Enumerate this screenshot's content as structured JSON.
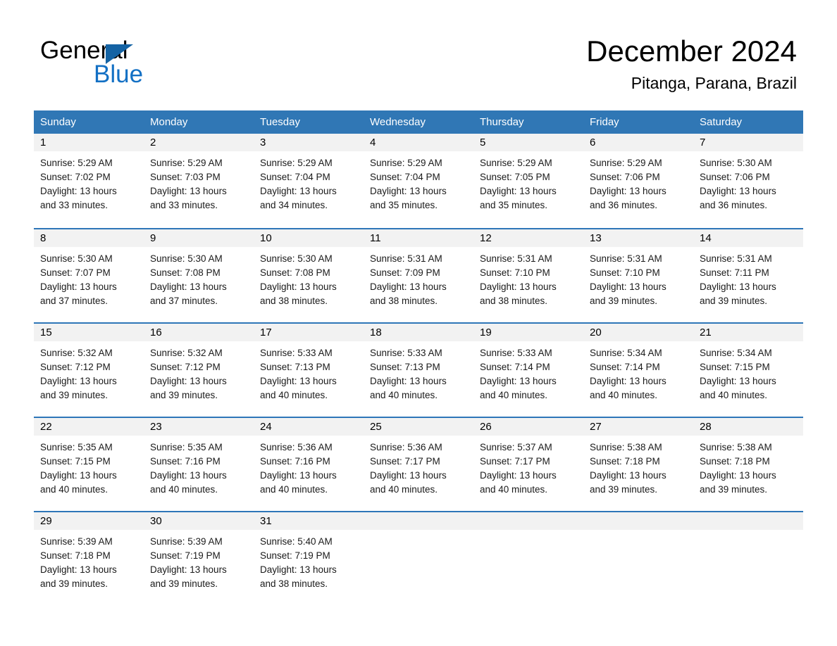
{
  "brand": {
    "name_line1": "General",
    "name_line2": "Blue",
    "triangle_icon": "triangle-icon",
    "black": "#000000",
    "blue": "#1370c4"
  },
  "header": {
    "month_title": "December 2024",
    "location": "Pitanga, Parana, Brazil"
  },
  "theme": {
    "header_blue": "#3077b5",
    "row_divider_blue": "#2e76b8",
    "day_strip_gray": "#f2f2f2"
  },
  "calendar": {
    "weekdays": [
      "Sunday",
      "Monday",
      "Tuesday",
      "Wednesday",
      "Thursday",
      "Friday",
      "Saturday"
    ],
    "weeks": [
      [
        {
          "day": "1",
          "sunrise": "Sunrise: 5:29 AM",
          "sunset": "Sunset: 7:02 PM",
          "daylight1": "Daylight: 13 hours",
          "daylight2": "and 33 minutes."
        },
        {
          "day": "2",
          "sunrise": "Sunrise: 5:29 AM",
          "sunset": "Sunset: 7:03 PM",
          "daylight1": "Daylight: 13 hours",
          "daylight2": "and 33 minutes."
        },
        {
          "day": "3",
          "sunrise": "Sunrise: 5:29 AM",
          "sunset": "Sunset: 7:04 PM",
          "daylight1": "Daylight: 13 hours",
          "daylight2": "and 34 minutes."
        },
        {
          "day": "4",
          "sunrise": "Sunrise: 5:29 AM",
          "sunset": "Sunset: 7:04 PM",
          "daylight1": "Daylight: 13 hours",
          "daylight2": "and 35 minutes."
        },
        {
          "day": "5",
          "sunrise": "Sunrise: 5:29 AM",
          "sunset": "Sunset: 7:05 PM",
          "daylight1": "Daylight: 13 hours",
          "daylight2": "and 35 minutes."
        },
        {
          "day": "6",
          "sunrise": "Sunrise: 5:29 AM",
          "sunset": "Sunset: 7:06 PM",
          "daylight1": "Daylight: 13 hours",
          "daylight2": "and 36 minutes."
        },
        {
          "day": "7",
          "sunrise": "Sunrise: 5:30 AM",
          "sunset": "Sunset: 7:06 PM",
          "daylight1": "Daylight: 13 hours",
          "daylight2": "and 36 minutes."
        }
      ],
      [
        {
          "day": "8",
          "sunrise": "Sunrise: 5:30 AM",
          "sunset": "Sunset: 7:07 PM",
          "daylight1": "Daylight: 13 hours",
          "daylight2": "and 37 minutes."
        },
        {
          "day": "9",
          "sunrise": "Sunrise: 5:30 AM",
          "sunset": "Sunset: 7:08 PM",
          "daylight1": "Daylight: 13 hours",
          "daylight2": "and 37 minutes."
        },
        {
          "day": "10",
          "sunrise": "Sunrise: 5:30 AM",
          "sunset": "Sunset: 7:08 PM",
          "daylight1": "Daylight: 13 hours",
          "daylight2": "and 38 minutes."
        },
        {
          "day": "11",
          "sunrise": "Sunrise: 5:31 AM",
          "sunset": "Sunset: 7:09 PM",
          "daylight1": "Daylight: 13 hours",
          "daylight2": "and 38 minutes."
        },
        {
          "day": "12",
          "sunrise": "Sunrise: 5:31 AM",
          "sunset": "Sunset: 7:10 PM",
          "daylight1": "Daylight: 13 hours",
          "daylight2": "and 38 minutes."
        },
        {
          "day": "13",
          "sunrise": "Sunrise: 5:31 AM",
          "sunset": "Sunset: 7:10 PM",
          "daylight1": "Daylight: 13 hours",
          "daylight2": "and 39 minutes."
        },
        {
          "day": "14",
          "sunrise": "Sunrise: 5:31 AM",
          "sunset": "Sunset: 7:11 PM",
          "daylight1": "Daylight: 13 hours",
          "daylight2": "and 39 minutes."
        }
      ],
      [
        {
          "day": "15",
          "sunrise": "Sunrise: 5:32 AM",
          "sunset": "Sunset: 7:12 PM",
          "daylight1": "Daylight: 13 hours",
          "daylight2": "and 39 minutes."
        },
        {
          "day": "16",
          "sunrise": "Sunrise: 5:32 AM",
          "sunset": "Sunset: 7:12 PM",
          "daylight1": "Daylight: 13 hours",
          "daylight2": "and 39 minutes."
        },
        {
          "day": "17",
          "sunrise": "Sunrise: 5:33 AM",
          "sunset": "Sunset: 7:13 PM",
          "daylight1": "Daylight: 13 hours",
          "daylight2": "and 40 minutes."
        },
        {
          "day": "18",
          "sunrise": "Sunrise: 5:33 AM",
          "sunset": "Sunset: 7:13 PM",
          "daylight1": "Daylight: 13 hours",
          "daylight2": "and 40 minutes."
        },
        {
          "day": "19",
          "sunrise": "Sunrise: 5:33 AM",
          "sunset": "Sunset: 7:14 PM",
          "daylight1": "Daylight: 13 hours",
          "daylight2": "and 40 minutes."
        },
        {
          "day": "20",
          "sunrise": "Sunrise: 5:34 AM",
          "sunset": "Sunset: 7:14 PM",
          "daylight1": "Daylight: 13 hours",
          "daylight2": "and 40 minutes."
        },
        {
          "day": "21",
          "sunrise": "Sunrise: 5:34 AM",
          "sunset": "Sunset: 7:15 PM",
          "daylight1": "Daylight: 13 hours",
          "daylight2": "and 40 minutes."
        }
      ],
      [
        {
          "day": "22",
          "sunrise": "Sunrise: 5:35 AM",
          "sunset": "Sunset: 7:15 PM",
          "daylight1": "Daylight: 13 hours",
          "daylight2": "and 40 minutes."
        },
        {
          "day": "23",
          "sunrise": "Sunrise: 5:35 AM",
          "sunset": "Sunset: 7:16 PM",
          "daylight1": "Daylight: 13 hours",
          "daylight2": "and 40 minutes."
        },
        {
          "day": "24",
          "sunrise": "Sunrise: 5:36 AM",
          "sunset": "Sunset: 7:16 PM",
          "daylight1": "Daylight: 13 hours",
          "daylight2": "and 40 minutes."
        },
        {
          "day": "25",
          "sunrise": "Sunrise: 5:36 AM",
          "sunset": "Sunset: 7:17 PM",
          "daylight1": "Daylight: 13 hours",
          "daylight2": "and 40 minutes."
        },
        {
          "day": "26",
          "sunrise": "Sunrise: 5:37 AM",
          "sunset": "Sunset: 7:17 PM",
          "daylight1": "Daylight: 13 hours",
          "daylight2": "and 40 minutes."
        },
        {
          "day": "27",
          "sunrise": "Sunrise: 5:38 AM",
          "sunset": "Sunset: 7:18 PM",
          "daylight1": "Daylight: 13 hours",
          "daylight2": "and 39 minutes."
        },
        {
          "day": "28",
          "sunrise": "Sunrise: 5:38 AM",
          "sunset": "Sunset: 7:18 PM",
          "daylight1": "Daylight: 13 hours",
          "daylight2": "and 39 minutes."
        }
      ],
      [
        {
          "day": "29",
          "sunrise": "Sunrise: 5:39 AM",
          "sunset": "Sunset: 7:18 PM",
          "daylight1": "Daylight: 13 hours",
          "daylight2": "and 39 minutes."
        },
        {
          "day": "30",
          "sunrise": "Sunrise: 5:39 AM",
          "sunset": "Sunset: 7:19 PM",
          "daylight1": "Daylight: 13 hours",
          "daylight2": "and 39 minutes."
        },
        {
          "day": "31",
          "sunrise": "Sunrise: 5:40 AM",
          "sunset": "Sunset: 7:19 PM",
          "daylight1": "Daylight: 13 hours",
          "daylight2": "and 38 minutes."
        },
        {
          "day": "",
          "sunrise": "",
          "sunset": "",
          "daylight1": "",
          "daylight2": ""
        },
        {
          "day": "",
          "sunrise": "",
          "sunset": "",
          "daylight1": "",
          "daylight2": ""
        },
        {
          "day": "",
          "sunrise": "",
          "sunset": "",
          "daylight1": "",
          "daylight2": ""
        },
        {
          "day": "",
          "sunrise": "",
          "sunset": "",
          "daylight1": "",
          "daylight2": ""
        }
      ]
    ]
  }
}
